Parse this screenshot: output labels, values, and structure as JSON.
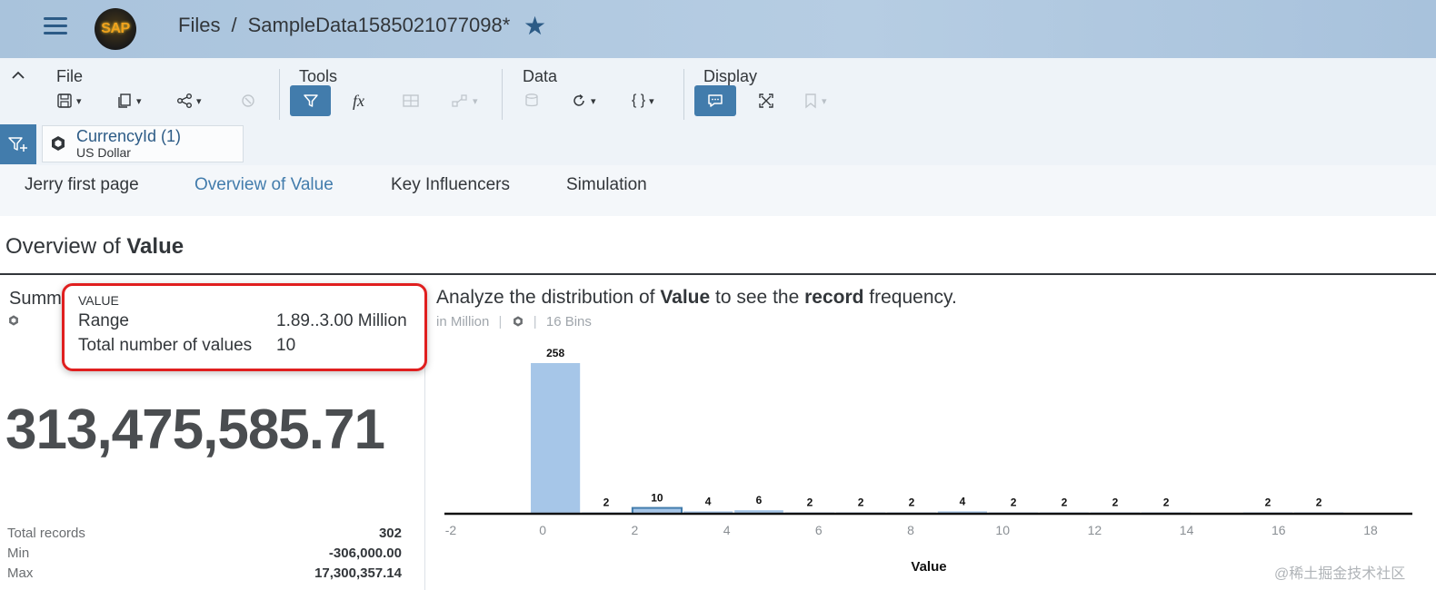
{
  "shell": {
    "logo_text": "SAP",
    "breadcrumb": {
      "root": "Files",
      "separator": "/",
      "file": "SampleData1585021077098*"
    },
    "brand_color": "#427cac"
  },
  "toolbar": {
    "file": {
      "label": "File"
    },
    "tools": {
      "label": "Tools"
    },
    "data": {
      "label": "Data",
      "script_icon_text": "{ }"
    },
    "display": {
      "label": "Display"
    },
    "formula_text": "fx"
  },
  "filter": {
    "name": "CurrencyId (1)",
    "value": "US Dollar"
  },
  "tabs": [
    {
      "label": "Jerry first page",
      "selected": false
    },
    {
      "label": "Overview of Value",
      "selected": true
    },
    {
      "label": "Key Influencers",
      "selected": false
    },
    {
      "label": "Simulation",
      "selected": false
    }
  ],
  "page": {
    "title_prefix": "Overview of ",
    "title_bold": "Value"
  },
  "summary": {
    "title": "Summ",
    "big_number": "313,475,585.71",
    "stats": [
      {
        "label": "Total records",
        "value": "302"
      },
      {
        "label": "Min",
        "value": "-306,000.00"
      },
      {
        "label": "Max",
        "value": "17,300,357.14"
      }
    ]
  },
  "tooltip": {
    "header": "VALUE",
    "rows": [
      {
        "label": "Range",
        "value": "1.89..3.00 Million"
      },
      {
        "label": "Total number of values",
        "value": "10"
      }
    ],
    "highlight_color": "#e01f1f"
  },
  "distribution": {
    "title_parts": [
      "Analyze the distribution of ",
      "Value",
      " to see the ",
      "record",
      " frequency."
    ],
    "subtitle": "in Million",
    "bins_label": "16 Bins"
  },
  "chart_data": {
    "type": "bar",
    "xlabel": "Value",
    "ylabel": "",
    "x_ticks": [
      -2,
      0,
      2,
      4,
      6,
      8,
      10,
      12,
      14,
      16,
      18
    ],
    "xlim": [
      -2,
      19
    ],
    "bins": [
      {
        "start": -0.28,
        "end": 0.83,
        "count": 258
      },
      {
        "start": 0.83,
        "end": 1.93,
        "count": 2
      },
      {
        "start": 1.93,
        "end": 3.04,
        "count": 10,
        "highlighted": true
      },
      {
        "start": 3.04,
        "end": 4.15,
        "count": 4
      },
      {
        "start": 4.15,
        "end": 5.25,
        "count": 6
      },
      {
        "start": 5.25,
        "end": 6.36,
        "count": 2
      },
      {
        "start": 6.36,
        "end": 7.47,
        "count": 2
      },
      {
        "start": 7.47,
        "end": 8.57,
        "count": 2
      },
      {
        "start": 8.57,
        "end": 9.68,
        "count": 4
      },
      {
        "start": 9.68,
        "end": 10.79,
        "count": 2
      },
      {
        "start": 10.79,
        "end": 11.89,
        "count": 2
      },
      {
        "start": 11.89,
        "end": 13.0,
        "count": 2
      },
      {
        "start": 13.0,
        "end": 14.11,
        "count": 2
      },
      {
        "start": 14.11,
        "end": 15.21,
        "count": 0
      },
      {
        "start": 15.21,
        "end": 16.32,
        "count": 2
      },
      {
        "start": 16.32,
        "end": 17.43,
        "count": 2
      }
    ],
    "bar_color": "#a6c6e8",
    "highlight_border_color": "#427cac"
  },
  "watermark": "@稀土掘金技术社区"
}
